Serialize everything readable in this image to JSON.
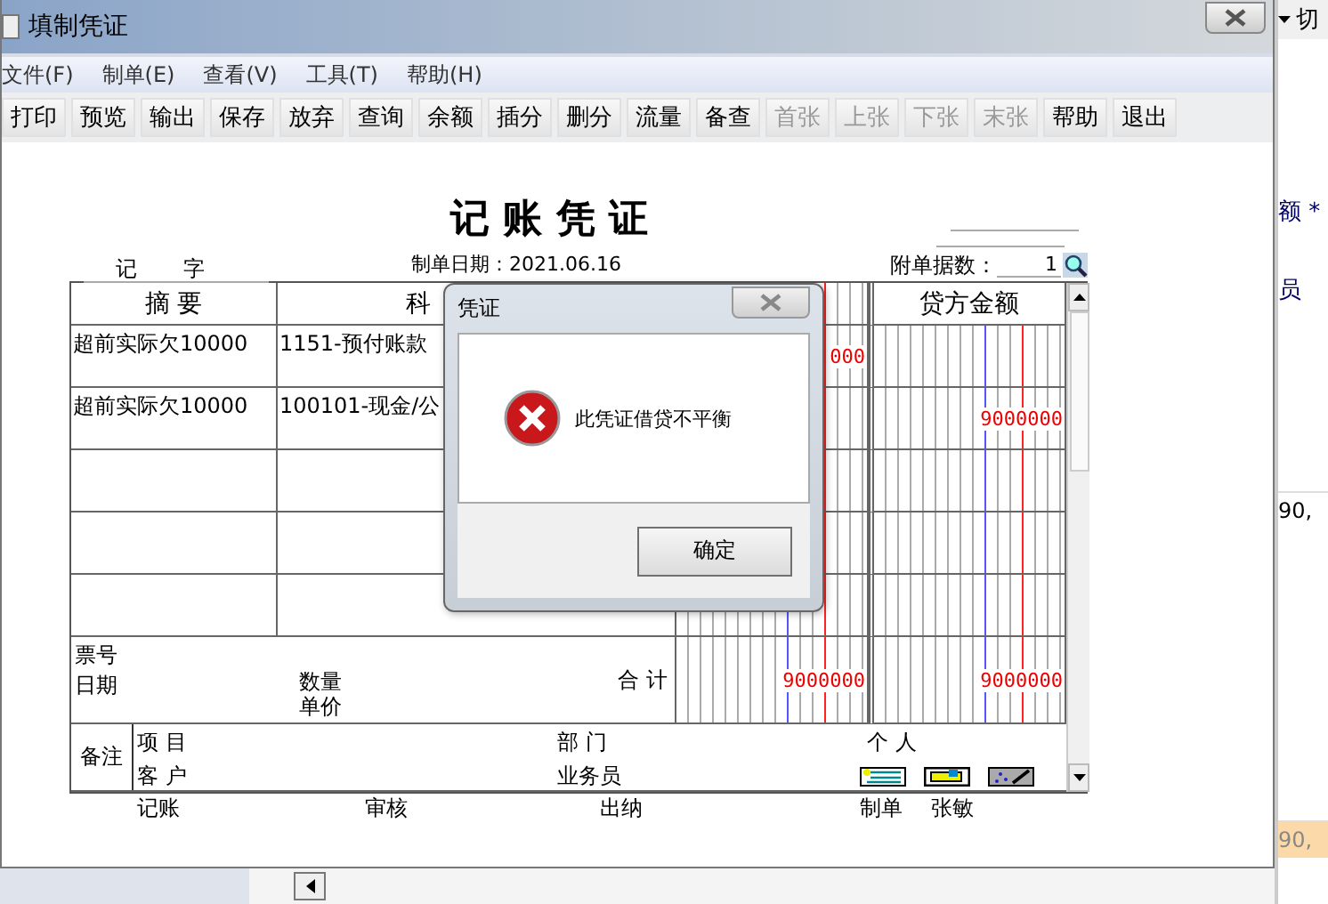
{
  "window": {
    "title": "填制凭证"
  },
  "menu": [
    "文件(F)",
    "制单(E)",
    "查看(V)",
    "工具(T)",
    "帮助(H)"
  ],
  "toolbar": [
    {
      "label": "打印",
      "disabled": false
    },
    {
      "label": "预览",
      "disabled": false
    },
    {
      "label": "输出",
      "disabled": false
    },
    {
      "label": "保存",
      "disabled": false
    },
    {
      "label": "放弃",
      "disabled": false
    },
    {
      "label": "查询",
      "disabled": false
    },
    {
      "label": "余额",
      "disabled": false
    },
    {
      "label": "插分",
      "disabled": false
    },
    {
      "label": "删分",
      "disabled": false
    },
    {
      "label": "流量",
      "disabled": false
    },
    {
      "label": "备查",
      "disabled": false
    },
    {
      "label": "首张",
      "disabled": true
    },
    {
      "label": "上张",
      "disabled": true
    },
    {
      "label": "下张",
      "disabled": true
    },
    {
      "label": "末张",
      "disabled": true
    },
    {
      "label": "帮助",
      "disabled": false
    },
    {
      "label": "退出",
      "disabled": false
    }
  ],
  "voucher": {
    "title": "记 账 凭 证",
    "type": "记",
    "type_suffix": "字",
    "date": "制单日期：2021.06.16",
    "attachments_label": "附单据数：",
    "attachments": "1",
    "columns": {
      "summary": "摘 要",
      "account": "科",
      "credit": "贷方金额"
    },
    "rows": [
      {
        "summary": "超前实际欠10000",
        "account": "1151-预付账款",
        "debit": "000"
      },
      {
        "summary": "超前实际欠10000",
        "account": "100101-现金/公",
        "credit": "9000000"
      },
      {},
      {},
      {}
    ],
    "ticket_labels": [
      "票号",
      "日期"
    ],
    "quantity_labels": [
      "数量",
      "单价"
    ],
    "total_label": "合 计",
    "debit_total": "9000000",
    "credit_total": "9000000",
    "remarks_label": "备注",
    "project_label": "项 目",
    "customer_label": "客 户",
    "department_label": "部 门",
    "staff_label": "业务员",
    "person_label": "个 人",
    "signatures": [
      "记账",
      "审核",
      "出纳"
    ],
    "preparer_label": "制单",
    "preparer": "张敏"
  },
  "dialog": {
    "title": "凭证",
    "message": "此凭证借贷不平衡",
    "button": "确定"
  },
  "background_app": {
    "top_label": "切",
    "labels": [
      "额 *",
      "员"
    ],
    "rows": [
      {
        "value": "90,",
        "selected": false
      },
      {
        "value": "90,",
        "selected": true
      }
    ]
  }
}
